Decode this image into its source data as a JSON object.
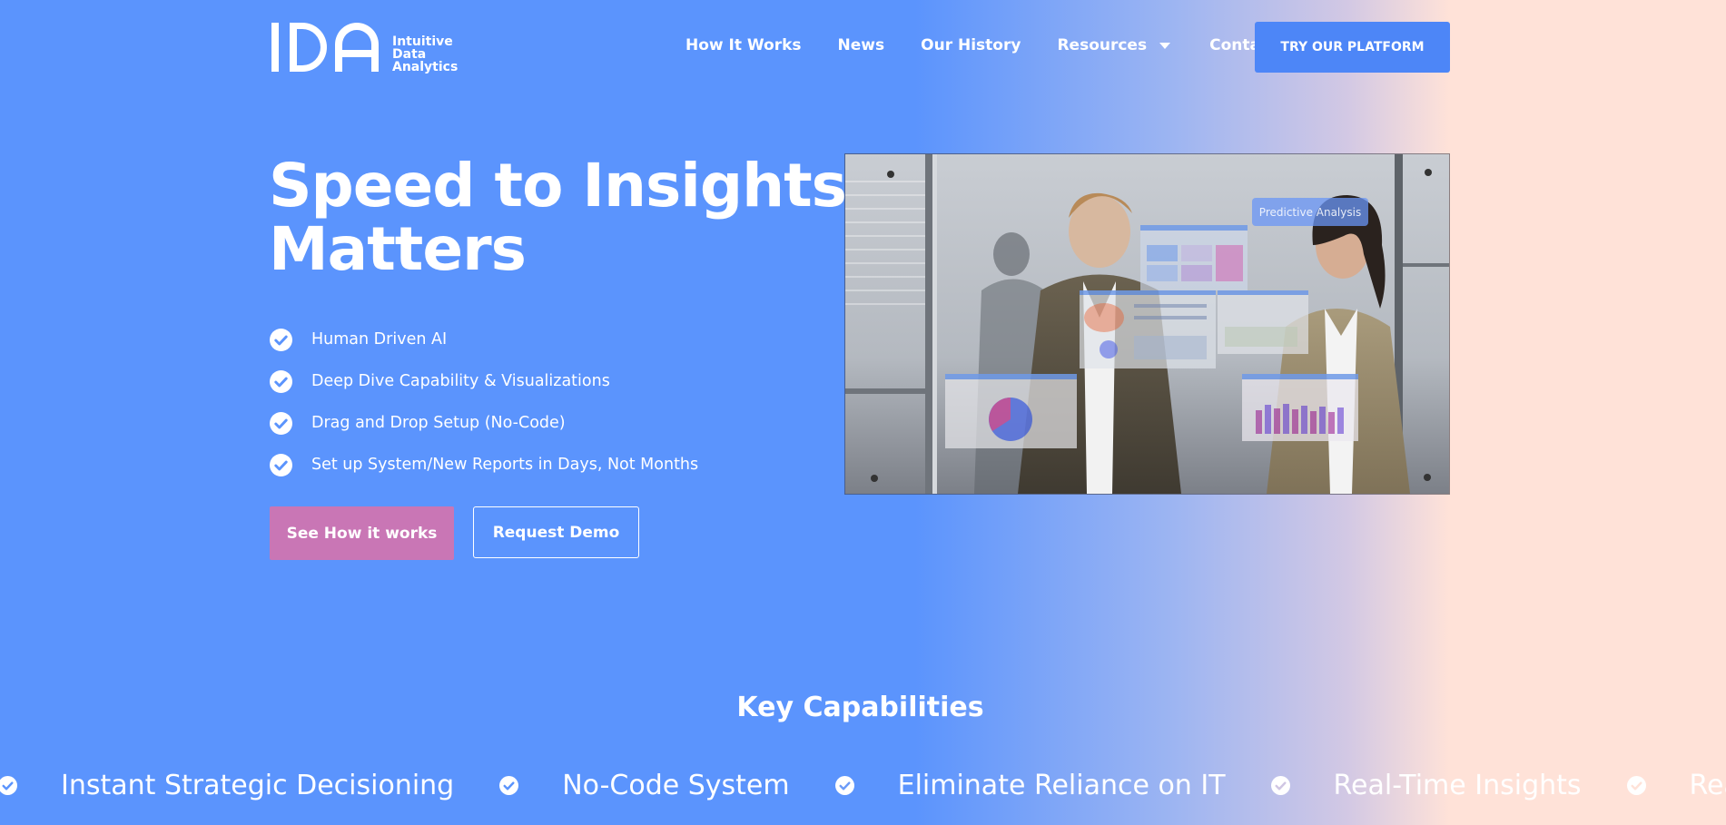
{
  "brand": {
    "logo_mark": "IDA",
    "name_lines": [
      "Intuitive",
      "Data",
      "Analytics"
    ]
  },
  "nav": {
    "items": [
      {
        "label": "How It Works"
      },
      {
        "label": "News"
      },
      {
        "label": "Our History"
      },
      {
        "label": "Resources",
        "has_dropdown": true
      },
      {
        "label": "Contact"
      }
    ],
    "cta": "TRY OUR PLATFORM"
  },
  "hero": {
    "title_line1": "Speed to Insights",
    "title_line2": "Matters",
    "features": [
      "Human Driven AI",
      "Deep Dive Capability & Visualizations",
      "Drag and Drop Setup (No-Code)",
      "Set up System/New Reports in Days, Not Months"
    ],
    "primary_button": "See How it works",
    "secondary_button": "Request Demo",
    "media": {
      "overlay_chip": "Predictive Analysis"
    }
  },
  "capabilities": {
    "title": "Key Capabilities",
    "items": [
      "Instant Strategic Decisioning",
      "No-Code System",
      "Eliminate Reliance on IT",
      "Real-Time Insights",
      "Real-Time Insights"
    ]
  },
  "colors": {
    "background_left": "#5b94fd",
    "background_right": "#ffe2d8",
    "cta_blue": "#4d86f7",
    "primary_pink": "#c976b5",
    "text": "#ffffff"
  },
  "icons": {
    "feature_bullet": "check-circle-icon",
    "ticker_separator": "check-circle-icon",
    "dropdown": "caret-down-icon"
  }
}
